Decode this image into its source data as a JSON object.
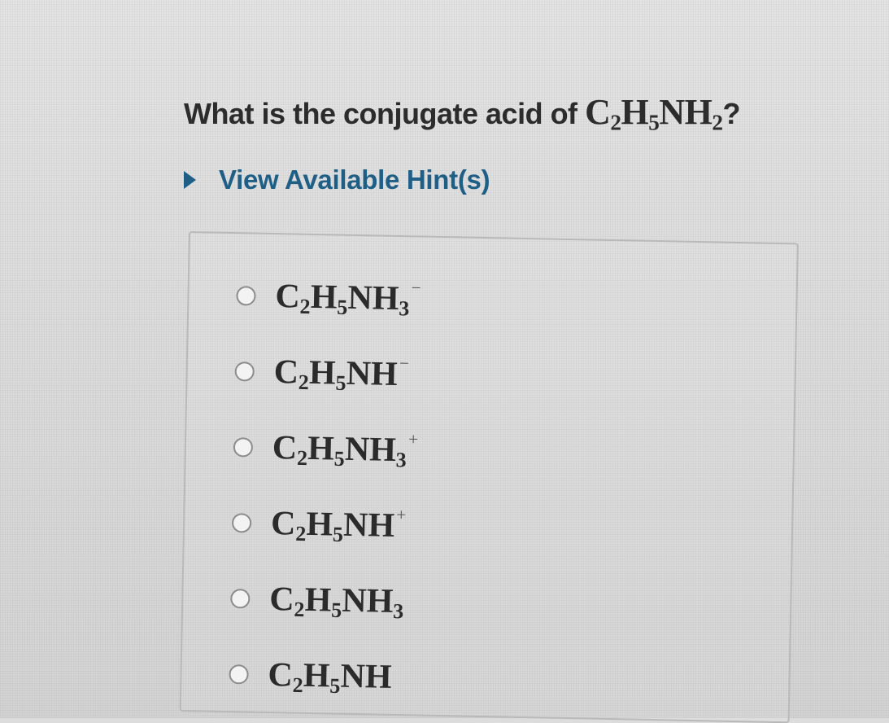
{
  "question": {
    "prefix": "What is the conjugate acid of",
    "formula": {
      "parts": [
        "C",
        "2",
        "H",
        "5",
        "NH",
        "2"
      ],
      "charge": ""
    },
    "suffix": "?"
  },
  "hint": {
    "label": "View Available Hint(s)",
    "icon": "caret-right-icon",
    "color": "#1f5f86"
  },
  "options": [
    {
      "parts": [
        "C",
        "2",
        "H",
        "5",
        "NH",
        "3"
      ],
      "charge": "−"
    },
    {
      "parts": [
        "C",
        "2",
        "H",
        "5",
        "NH",
        ""
      ],
      "charge": "−"
    },
    {
      "parts": [
        "C",
        "2",
        "H",
        "5",
        "NH",
        "3"
      ],
      "charge": "+"
    },
    {
      "parts": [
        "C",
        "2",
        "H",
        "5",
        "NH",
        ""
      ],
      "charge": "+"
    },
    {
      "parts": [
        "C",
        "2",
        "H",
        "5",
        "NH",
        "3"
      ],
      "charge": ""
    },
    {
      "parts": [
        "C",
        "2",
        "H",
        "5",
        "NH",
        ""
      ],
      "charge": ""
    }
  ]
}
